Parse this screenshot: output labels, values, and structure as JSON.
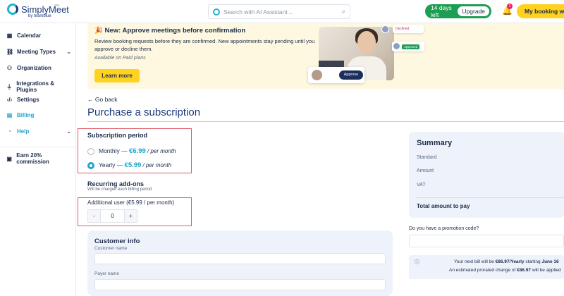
{
  "topbar": {
    "logo_text": "SimplyMeet",
    "logo_tag": ".me",
    "logo_by": "by teamblue",
    "search_placeholder": "Search with AI Assistant...",
    "trial_text": "14 days left",
    "upgrade_label": "Upgrade",
    "notification_count": "1",
    "booking_button": "My booking website"
  },
  "sidebar": {
    "items": [
      {
        "label": "Calendar",
        "icon": "calendar-icon"
      },
      {
        "label": "Meeting Types",
        "icon": "link-icon",
        "expandable": true
      },
      {
        "label": "Organization",
        "icon": "organization-icon"
      },
      {
        "label": "Integrations & Plugins",
        "icon": "plug-icon"
      },
      {
        "label": "Settings",
        "icon": "code-icon"
      },
      {
        "label": "Billing",
        "icon": "billing-icon",
        "active": true
      },
      {
        "label": "Help",
        "icon": "help-icon",
        "expandable": true
      },
      {
        "label": "Earn 20% commission",
        "icon": "gift-icon"
      }
    ]
  },
  "banner": {
    "title": "🎉 New: Approve meetings before confirmation",
    "description": "Review booking requests before they are confirmed. New appointments stay pending until you approve or decline them.",
    "note": "Available on Paid plans",
    "button": "Learn more",
    "declined_label": "Declined",
    "approved_label": "Approved",
    "approve_label": "Approve"
  },
  "main": {
    "back_label": "Go back",
    "page_title": "Purchase a subscription",
    "subscription": {
      "title": "Subscription period",
      "options": [
        {
          "label": "Monthly — ",
          "price": "€6.99",
          "per": " / per month",
          "selected": false
        },
        {
          "label": "Yearly — ",
          "price": "€5.99",
          "per": " / per month",
          "selected": true
        }
      ]
    },
    "addons": {
      "title": "Recurring add-ons",
      "subtitle": "Will be charged each billing period",
      "item_label": "Additional user (€5.99 / per month)",
      "quantity": "0",
      "minus": "-",
      "plus": "+"
    },
    "customer": {
      "title": "Customer info",
      "name_label": "Customer name",
      "payer_label": "Payer name"
    }
  },
  "summary": {
    "title": "Summary",
    "rows": [
      "Standard",
      "Amount",
      "VAT"
    ],
    "total_label": "Total amount to pay",
    "promo_label": "Do you have a promotion code?",
    "bill_line1_prefix": "Your next bill will be ",
    "bill_line1_amount": "€86.97/Yearly",
    "bill_line1_mid": " starting ",
    "bill_line1_date": "June 16",
    "bill_line2_prefix": "An estimated prorated change of ",
    "bill_line2_amount": "€86.97",
    "bill_line2_suffix": " will be applied"
  },
  "colors": {
    "accent": "#22a4cc",
    "brand_yellow": "#ffd21f",
    "trial_green": "#1d9e53",
    "highlight_border": "#e05a6a"
  }
}
